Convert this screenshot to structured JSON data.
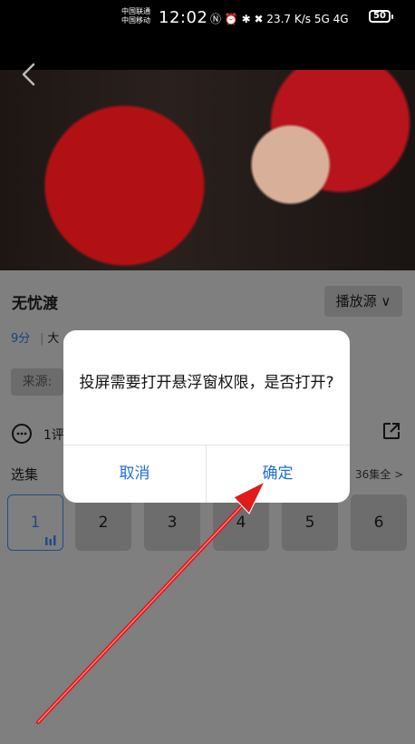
{
  "status_bar": {
    "carrier_1": "中国联通",
    "carrier_2": "中国移动",
    "time": "12:02",
    "icons_text": "Ⓝ ⏰ ✱ ✖ 23.7 K/s 5G 4G",
    "battery": "50"
  },
  "video": {
    "back_icon": "chevron-left-icon"
  },
  "details": {
    "title": "无忧渡",
    "source_button": "播放源 ∨",
    "rating": "9分",
    "rating_extra": "大",
    "source_label": "来源:",
    "comment_label": "1评",
    "episodes_label": "选集",
    "episodes_total": "36集全 >",
    "episodes": [
      "1",
      "2",
      "3",
      "4",
      "5",
      "6"
    ]
  },
  "dialog": {
    "message": "投屏需要打开悬浮窗权限，是否打开?",
    "cancel": "取消",
    "confirm": "确定"
  },
  "colors": {
    "accent": "#1e6fd9",
    "overlay": "#7f7f7f",
    "arrow": "#e11b1b"
  }
}
